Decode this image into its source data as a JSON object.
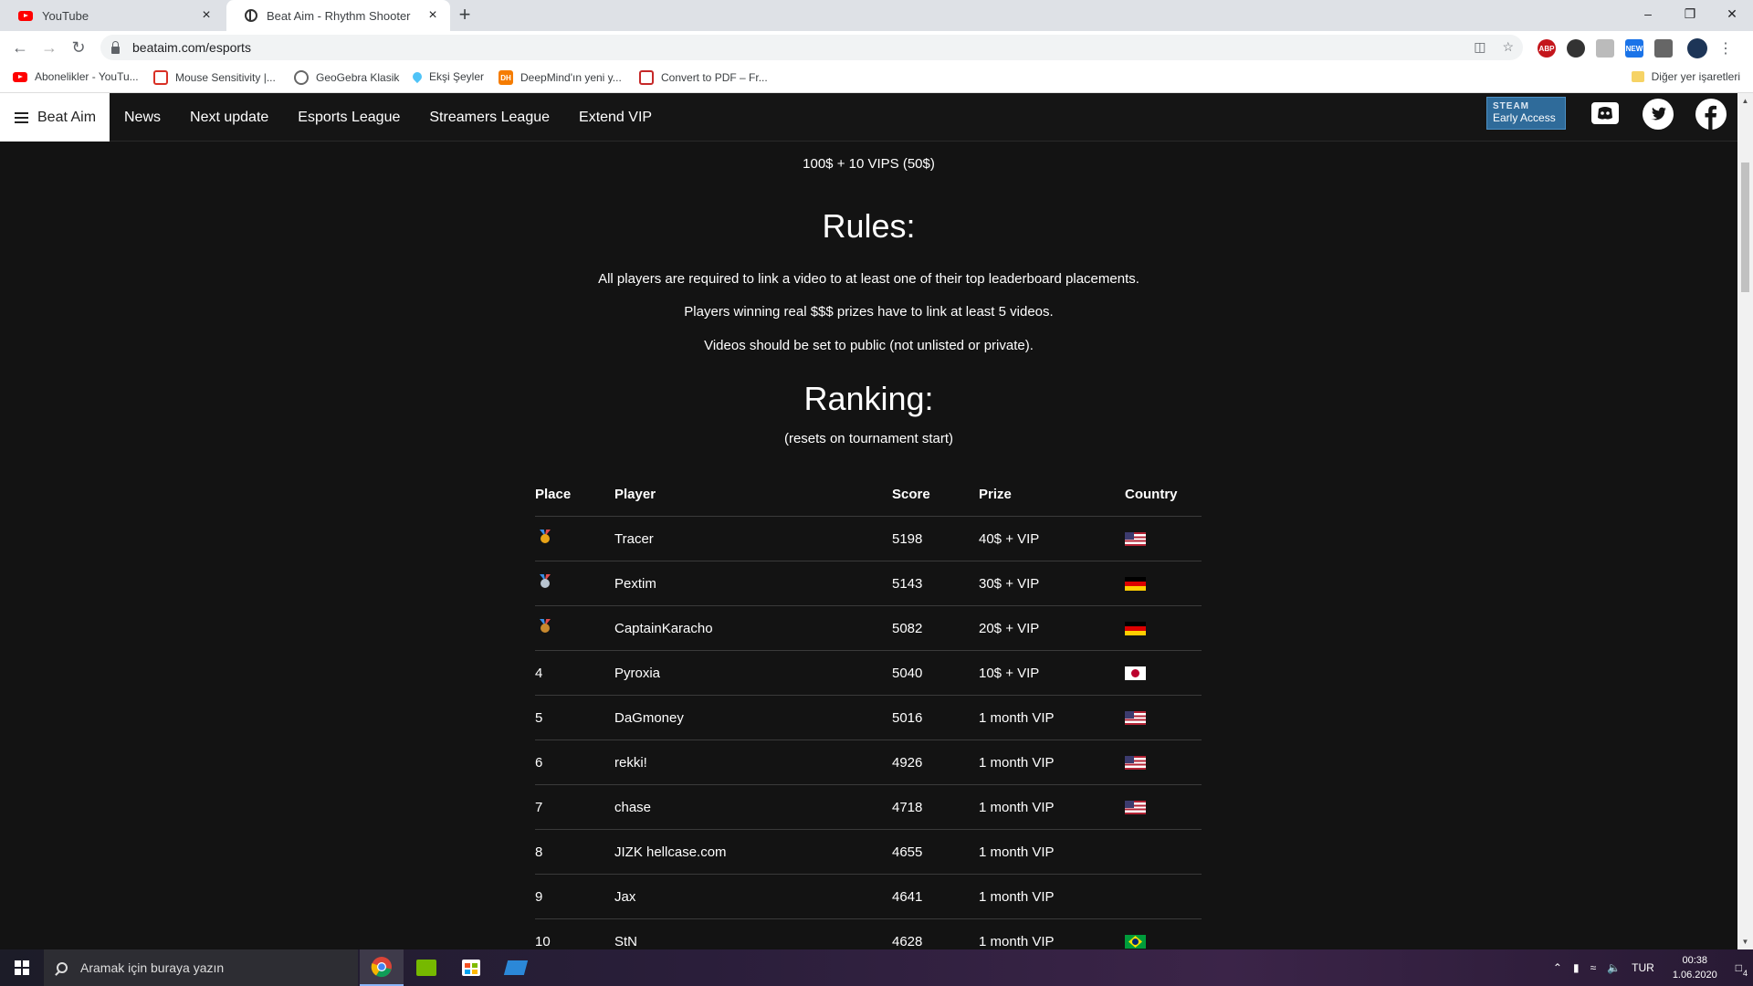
{
  "browser": {
    "tabs": [
      {
        "title": "YouTube",
        "active": false
      },
      {
        "title": "Beat Aim - Rhythm Shooter",
        "active": true
      }
    ],
    "url": "beataim.com/esports",
    "bookmarks": [
      {
        "label": "Abonelikler - YouTu...",
        "icon": "youtube-icon"
      },
      {
        "label": "Mouse Sensitivity |...",
        "icon": "mouse-sensitivity-icon"
      },
      {
        "label": "GeoGebra Klasik",
        "icon": "geogebra-icon"
      },
      {
        "label": "Ekşi Şeyler",
        "icon": "drop-icon"
      },
      {
        "label": "DeepMind'ın yeni y...",
        "icon": "dh-icon"
      },
      {
        "label": "Convert to PDF – Fr...",
        "icon": "pdf-icon"
      }
    ],
    "other_bookmarks": "Diğer yer işaretleri"
  },
  "site": {
    "brand": "Beat Aim",
    "nav": [
      "News",
      "Next update",
      "Esports League",
      "Streamers League",
      "Extend VIP"
    ],
    "steam_badge": {
      "top": "STEAM",
      "bottom": "Early Access"
    }
  },
  "content": {
    "prize_line": "100$ + 10 VIPS (50$)",
    "rules_title": "Rules:",
    "rules": [
      "All players are required to link a video to at least one of their top leaderboard placements.",
      "Players winning real $$$ prizes have to link at least 5 videos.",
      "Videos should be set to public (not unlisted or private)."
    ],
    "ranking_title": "Ranking:",
    "ranking_note": "(resets on tournament start)",
    "table": {
      "headers": [
        "Place",
        "Player",
        "Score",
        "Prize",
        "Country"
      ],
      "rows": [
        {
          "place": "",
          "medal": "gold",
          "player": "Tracer",
          "score": "5198",
          "prize": "40$ + VIP",
          "country": "us"
        },
        {
          "place": "",
          "medal": "silver",
          "player": "Pextim",
          "score": "5143",
          "prize": "30$ + VIP",
          "country": "de"
        },
        {
          "place": "",
          "medal": "bronze",
          "player": "CaptainKaracho",
          "score": "5082",
          "prize": "20$ + VIP",
          "country": "de"
        },
        {
          "place": "4",
          "medal": "",
          "player": "Pyroxia",
          "score": "5040",
          "prize": "10$ + VIP",
          "country": "jp"
        },
        {
          "place": "5",
          "medal": "",
          "player": "DaGmoney",
          "score": "5016",
          "prize": "1 month VIP",
          "country": "us"
        },
        {
          "place": "6",
          "medal": "",
          "player": "rekki!",
          "score": "4926",
          "prize": "1 month VIP",
          "country": "us"
        },
        {
          "place": "7",
          "medal": "",
          "player": "chase",
          "score": "4718",
          "prize": "1 month VIP",
          "country": "us"
        },
        {
          "place": "8",
          "medal": "",
          "player": "JIZK hellcase.com",
          "score": "4655",
          "prize": "1 month VIP",
          "country": ""
        },
        {
          "place": "9",
          "medal": "",
          "player": "Jax",
          "score": "4641",
          "prize": "1 month VIP",
          "country": ""
        },
        {
          "place": "10",
          "medal": "",
          "player": "StN",
          "score": "4628",
          "prize": "1 month VIP",
          "country": "br"
        }
      ]
    }
  },
  "taskbar": {
    "search_placeholder": "Aramak için buraya yazın",
    "language": "TUR",
    "time": "00:38",
    "date": "1.06.2020",
    "notification_count": "4"
  },
  "colors": {
    "page_bg": "#131313",
    "nav_bg": "#151515",
    "steam_blue": "#2f6b9a",
    "medal_gold": "#e8a317",
    "medal_silver": "#b8c4d0",
    "medal_bronze": "#c8892e"
  }
}
